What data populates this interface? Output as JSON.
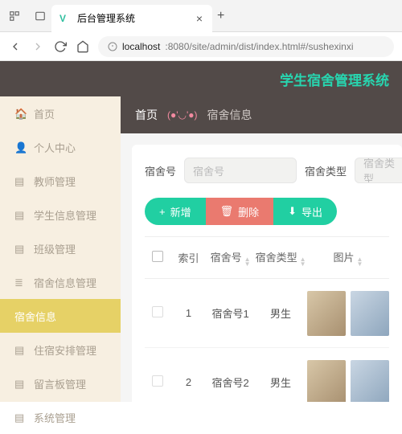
{
  "browser": {
    "tab_title": "后台管理系统",
    "url_host": "localhost",
    "url_path": ":8080/site/admin/dist/index.html#/sushexinxi"
  },
  "header": {
    "title": "学生宿舍管理系统"
  },
  "sidebar": {
    "items": [
      {
        "label": "首页"
      },
      {
        "label": "个人中心"
      },
      {
        "label": "教师管理"
      },
      {
        "label": "学生信息管理"
      },
      {
        "label": "班级管理"
      },
      {
        "label": "宿舍信息管理"
      },
      {
        "label": "宿舍信息"
      },
      {
        "label": "住宿安排管理"
      },
      {
        "label": "留言板管理"
      },
      {
        "label": "系统管理"
      }
    ]
  },
  "breadcrumb": {
    "home": "首页",
    "face": "(●'◡'●)",
    "current": "宿舍信息"
  },
  "search": {
    "dorm_label": "宿舍号",
    "dorm_ph": "宿舍号",
    "type_label": "宿舍类型",
    "type_ph": "宿舍类型"
  },
  "buttons": {
    "add": "新增",
    "del": "删除",
    "exp": "导出"
  },
  "table": {
    "cols": {
      "idx": "索引",
      "dorm": "宿舍号",
      "type": "宿舍类型",
      "img": "图片"
    },
    "rows": [
      {
        "idx": "1",
        "dorm": "宿舍号1",
        "type": "男生"
      },
      {
        "idx": "2",
        "dorm": "宿舍号2",
        "type": "男生"
      }
    ]
  }
}
